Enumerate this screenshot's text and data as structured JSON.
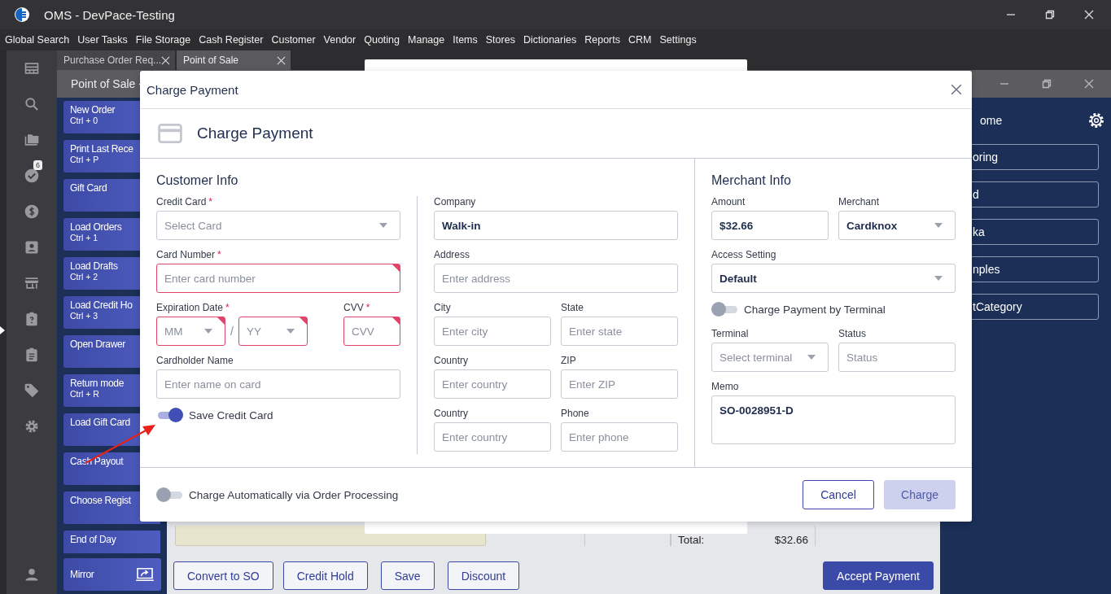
{
  "window": {
    "title": "OMS - DevPace-Testing"
  },
  "menu": [
    "Global Search",
    "User Tasks",
    "File Storage",
    "Cash Register",
    "Customer",
    "Vendor",
    "Quoting",
    "Manage",
    "Items",
    "Stores",
    "Dictionaries",
    "Reports",
    "CRM",
    "Settings"
  ],
  "tabs": [
    {
      "label": "Purchase Order Req...",
      "selected": false
    },
    {
      "label": "Point of Sale",
      "selected": true
    }
  ],
  "rail_badge": "6",
  "pos": {
    "title": "Point of Sale -",
    "actions": [
      {
        "label": "New Order",
        "shortcut": "Ctrl + 0"
      },
      {
        "label": "Print Last Rece",
        "shortcut": "Ctrl + P"
      },
      {
        "label": "Gift Card"
      },
      {
        "label": "Load Orders",
        "shortcut": "Ctrl + 1"
      },
      {
        "label": "Load Drafts",
        "shortcut": "Ctrl + 2"
      },
      {
        "label": "Load Credit Ho",
        "shortcut": "Ctrl + 3"
      },
      {
        "label": "Open Drawer"
      },
      {
        "label": "Return mode",
        "shortcut": "Ctrl + R"
      },
      {
        "label": "Load Gift Card"
      },
      {
        "label": "Cash Payout"
      },
      {
        "label": "Choose Regist"
      },
      {
        "label": "End of Day"
      }
    ],
    "mirror": "Mirror",
    "total_label": "Total:",
    "total": "$32.66",
    "buttons": [
      {
        "label": "Convert to SO",
        "kind": "outline"
      },
      {
        "label": "Credit Hold",
        "kind": "outline"
      },
      {
        "label": "Save",
        "kind": "outline"
      },
      {
        "label": "Discount",
        "kind": "outline"
      },
      {
        "label": "Accept Payment",
        "kind": "primary"
      }
    ]
  },
  "side_panel": {
    "home": "ome",
    "items": [
      "oring",
      "d",
      "ka",
      "nples",
      "tCategory"
    ]
  },
  "dialog": {
    "title": "Charge Payment",
    "heading": "Charge Payment",
    "columns": [
      {
        "heading": "Customer Info",
        "items": [
          {
            "kind": "row",
            "fields": [
              {
                "label": "Credit Card",
                "required_mark": "*",
                "kind": "select",
                "placeholder": "Select Card",
                "invalid": false
              }
            ]
          },
          {
            "kind": "row",
            "fields": [
              {
                "label": "Card Number",
                "required_mark": "*",
                "kind": "input",
                "placeholder": "Enter card number",
                "invalid": true
              }
            ]
          },
          {
            "kind": "row",
            "fields": [
              {
                "label": "Expiration Date",
                "required_mark": "*",
                "kind": "date",
                "separator": "/",
                "parts": [
                  {
                    "placeholder": "MM",
                    "invalid": true
                  },
                  {
                    "placeholder": "YY",
                    "invalid": true
                  }
                ]
              },
              {
                "label": "CVV",
                "required_mark": "*",
                "kind": "input",
                "placeholder": "CVV",
                "invalid": true
              }
            ]
          },
          {
            "kind": "row",
            "fields": [
              {
                "label": "Cardholder Name",
                "kind": "input",
                "placeholder": "Enter name on card",
                "invalid": false
              }
            ]
          },
          {
            "kind": "toggle",
            "label": "Save Credit Card",
            "on": true
          }
        ]
      },
      {
        "items": [
          {
            "kind": "row",
            "fields": [
              {
                "label": "Company",
                "kind": "input",
                "value": "Walk-in",
                "invalid": false
              }
            ]
          },
          {
            "kind": "row",
            "fields": [
              {
                "label": "Address",
                "kind": "input",
                "placeholder": "Enter address",
                "invalid": false
              }
            ]
          },
          {
            "kind": "row",
            "fields": [
              {
                "label": "City",
                "kind": "input",
                "placeholder": "Enter city",
                "invalid": false
              },
              {
                "label": "State",
                "kind": "input",
                "placeholder": "Enter state",
                "invalid": false
              }
            ]
          },
          {
            "kind": "row",
            "fields": [
              {
                "label": "Country",
                "kind": "input",
                "placeholder": "Enter country",
                "invalid": false
              },
              {
                "label": "ZIP",
                "kind": "input",
                "placeholder": "Enter ZIP",
                "invalid": false
              }
            ]
          },
          {
            "kind": "row",
            "fields": [
              {
                "label": "Country",
                "kind": "input",
                "placeholder": "Enter country",
                "invalid": false
              },
              {
                "label": "Phone",
                "kind": "input",
                "placeholder": "Enter phone",
                "invalid": false
              }
            ]
          }
        ]
      },
      {
        "heading": "Merchant Info",
        "items": [
          {
            "kind": "row",
            "fields": [
              {
                "label": "Amount",
                "kind": "input",
                "value": "$32.66",
                "invalid": false
              },
              {
                "label": "Merchant",
                "kind": "select",
                "value": "Cardknox",
                "invalid": false
              }
            ]
          },
          {
            "kind": "row",
            "fields": [
              {
                "label": "Access Setting",
                "kind": "select",
                "value": "Default",
                "invalid": false
              }
            ]
          },
          {
            "kind": "toggle",
            "label": "Charge Payment by Terminal",
            "on": false
          },
          {
            "kind": "row",
            "fields": [
              {
                "label": "Terminal",
                "kind": "select",
                "placeholder": "Select terminal",
                "invalid": false
              },
              {
                "label": "Status",
                "kind": "input",
                "placeholder": "Status",
                "invalid": false
              }
            ]
          },
          {
            "kind": "row",
            "fields": [
              {
                "label": "Memo",
                "kind": "textarea",
                "value": "SO-0028951-D"
              }
            ]
          }
        ]
      }
    ],
    "footer": {
      "toggle": {
        "label": "Charge Automatically via Order Processing",
        "on": false
      },
      "buttons": [
        {
          "label": "Cancel",
          "kind": "outline",
          "disabled": false
        },
        {
          "label": "Charge",
          "kind": "primary",
          "disabled": true
        }
      ]
    }
  }
}
